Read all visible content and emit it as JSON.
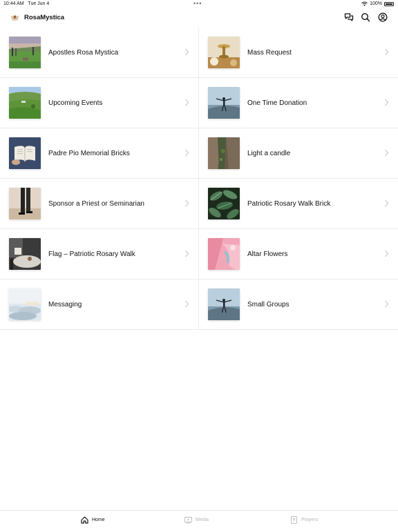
{
  "status": {
    "time": "10:44 AM",
    "date": "Tue Jun 4",
    "multitask_dots": "•••",
    "battery": "100%",
    "icons": [
      "wifi-icon",
      "battery-icon"
    ]
  },
  "header": {
    "title": "RosaMystica",
    "icons": [
      "chat-icon",
      "search-icon",
      "profile-icon"
    ]
  },
  "menu": {
    "items": [
      {
        "label": "Apostles Rosa Mystica",
        "thumb": "pilgrims-field"
      },
      {
        "label": "Mass Request",
        "thumb": "chalice"
      },
      {
        "label": "Upcoming Events",
        "thumb": "green-valley"
      },
      {
        "label": "One Time Donation",
        "thumb": "person-arms-open"
      },
      {
        "label": "Padre Pio Memorial Bricks",
        "thumb": "open-book"
      },
      {
        "label": "Light a candle",
        "thumb": "rock-cliff"
      },
      {
        "label": "Sponsor a Priest or Seminarian",
        "thumb": "walking-person"
      },
      {
        "label": "Patriotic Rosary Walk Brick",
        "thumb": "leaves"
      },
      {
        "label": "Flag – Patriotic Rosary Walk",
        "thumb": "cafe-table"
      },
      {
        "label": "Altar Flowers",
        "thumb": "pink-abstract"
      },
      {
        "label": "Messaging",
        "thumb": "clouds"
      },
      {
        "label": "Small Groups",
        "thumb": "person-arms-open"
      }
    ]
  },
  "tabs": {
    "home": "Home",
    "media": "Media",
    "prayers": "Prayers",
    "active": "home",
    "active_color": "#111111",
    "inactive_color": "#b8b8b8"
  }
}
